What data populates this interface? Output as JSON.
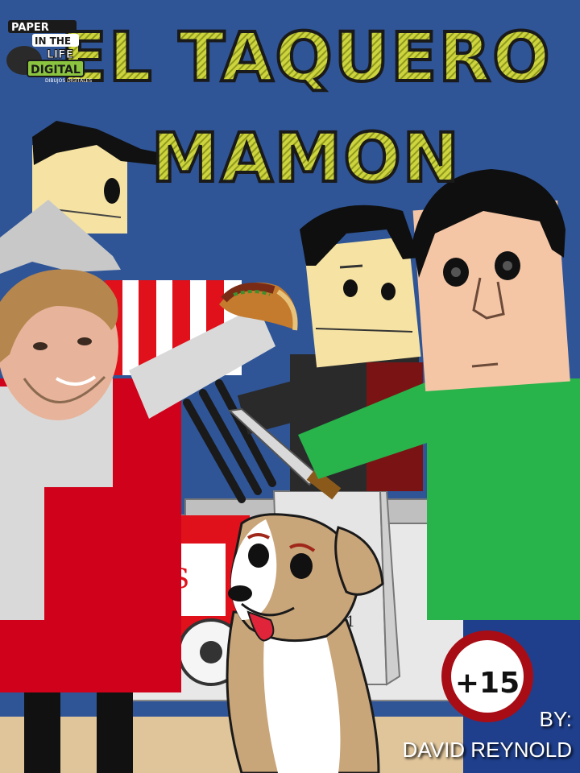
{
  "logo": {
    "line1": "PAPER",
    "line2": "IN THE",
    "line3": "LIFE",
    "line4": "DIGITAL",
    "tagline": "DIBUJOS DIGITALES"
  },
  "title": {
    "line1": "EL TAQUERO",
    "line2": "MAMON"
  },
  "age_rating": "+15",
  "price_sign": "$1",
  "cart_letter": "S",
  "credit": {
    "by": "BY:",
    "author": "DAVID REYNOLD"
  },
  "colors": {
    "background": "#2f5597",
    "title_fill": "#c9d13a",
    "title_outline": "#1a1a1a",
    "apron": "#d0021b",
    "shirt_green": "#28b34b",
    "ground": "#e0c59a"
  }
}
